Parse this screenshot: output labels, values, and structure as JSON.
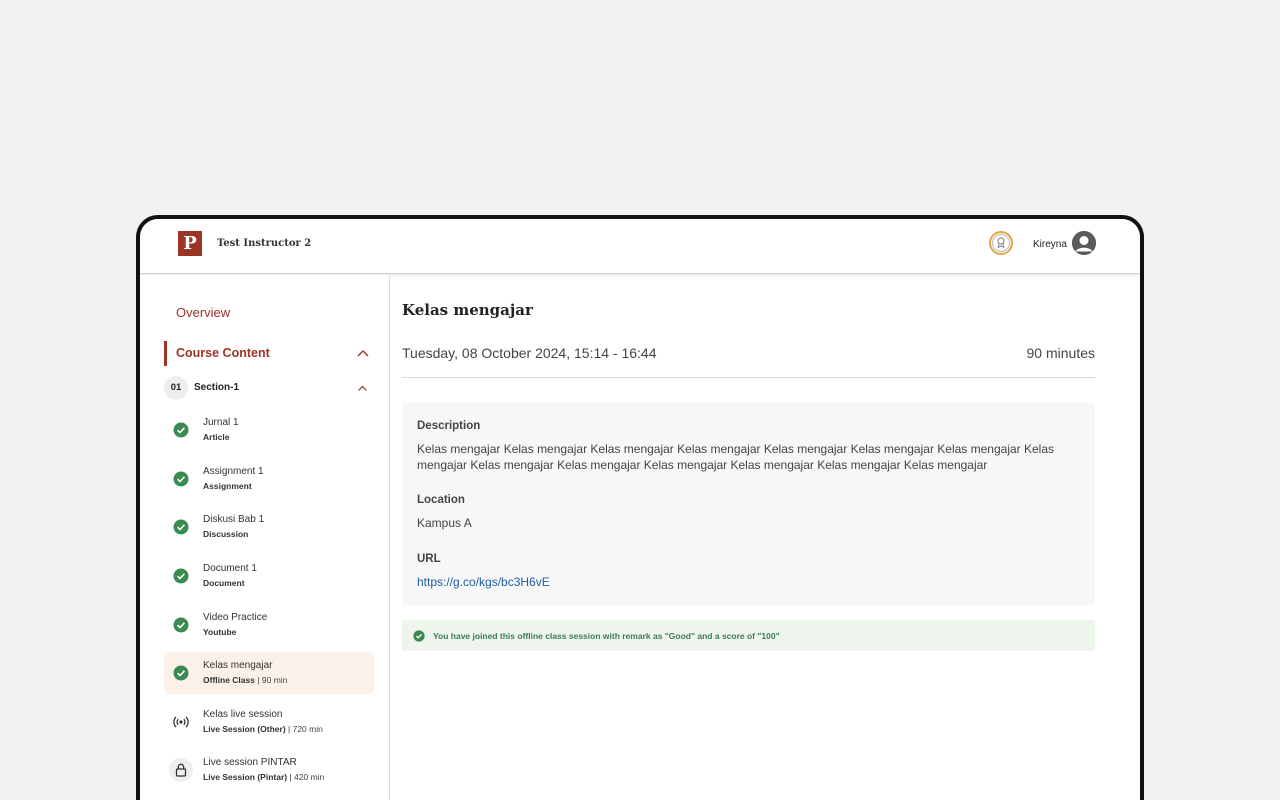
{
  "header": {
    "logo_letter": "P",
    "course_title": "Test Instructor 2",
    "badge_icon": "certificate-badge-icon",
    "username": "Kireyna",
    "accent_color": "#9b3326"
  },
  "sidebar": {
    "overview_label": "Overview",
    "course_content_label": "Course Content",
    "section": {
      "number": "01",
      "label": "Section-1"
    },
    "items": [
      {
        "title": "Jurnal 1",
        "type": "Article",
        "meta": "",
        "status": "completed"
      },
      {
        "title": "Assignment 1",
        "type": "Assignment",
        "meta": "",
        "status": "completed"
      },
      {
        "title": "Diskusi Bab 1",
        "type": "Discussion",
        "meta": "",
        "status": "completed"
      },
      {
        "title": "Document 1",
        "type": "Document",
        "meta": "",
        "status": "completed"
      },
      {
        "title": "Video Practice",
        "type": "Youtube",
        "meta": "",
        "status": "completed"
      },
      {
        "title": "Kelas mengajar",
        "type": "Offline Class",
        "meta": " | 90 min",
        "status": "completed",
        "active": true
      },
      {
        "title": "Kelas live session",
        "type": "Live Session (Other)",
        "meta": " | 720 min",
        "status": "live"
      },
      {
        "title": "Live session PINTAR",
        "type": "Live Session (Pintar)",
        "meta": " | 420 min",
        "status": "locked"
      }
    ]
  },
  "main": {
    "title": "Kelas mengajar",
    "date": "Tuesday, 08 October 2024, 15:14 - 16:44",
    "duration": "90 minutes",
    "description_label": "Description",
    "description": "Kelas mengajar Kelas mengajar Kelas mengajar Kelas mengajar Kelas mengajar Kelas mengajar Kelas mengajar Kelas mengajar Kelas mengajar Kelas mengajar Kelas mengajar Kelas mengajar Kelas mengajar Kelas mengajar",
    "location_label": "Location",
    "location": "Kampus A",
    "url_label": "URL",
    "url": "https://g.co/kgs/bc3H6vE",
    "notice": "You have joined this offline class session with remark as \"Good\" and a score of \"100\""
  }
}
